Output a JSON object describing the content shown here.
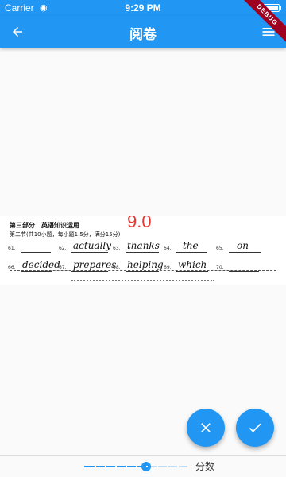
{
  "status_bar": {
    "carrier": "Carrier",
    "wifi_icon": "wifi-icon",
    "time": "9:29 PM",
    "battery_icon": "battery-icon"
  },
  "app_bar": {
    "title": "阅卷",
    "back_icon": "arrow-back-icon",
    "menu_icon": "menu-icon",
    "debug_banner": "DEBUG",
    "color": "#2196f3"
  },
  "sheet": {
    "section_title": "第三部分　英语知识运用",
    "subsection_title": "第二节(共10小题，每小题1.5分，满分15分)",
    "score": "9.0",
    "score_color": "#e53935",
    "answers": [
      {
        "num": "61.",
        "word": ""
      },
      {
        "num": "62.",
        "word": "actually"
      },
      {
        "num": "63.",
        "word": "thanks"
      },
      {
        "num": "64.",
        "word": "the"
      },
      {
        "num": "65.",
        "word": "on"
      },
      {
        "num": "66.",
        "word": "decided"
      },
      {
        "num": "67.",
        "word": "prepares"
      },
      {
        "num": "68.",
        "word": "helping"
      },
      {
        "num": "69.",
        "word": "which"
      },
      {
        "num": "70.",
        "word": ""
      }
    ]
  },
  "actions": {
    "reject_icon": "close-icon",
    "accept_icon": "check-icon"
  },
  "bottom_bar": {
    "slider_label": "分数",
    "slider_value": 0.6
  }
}
